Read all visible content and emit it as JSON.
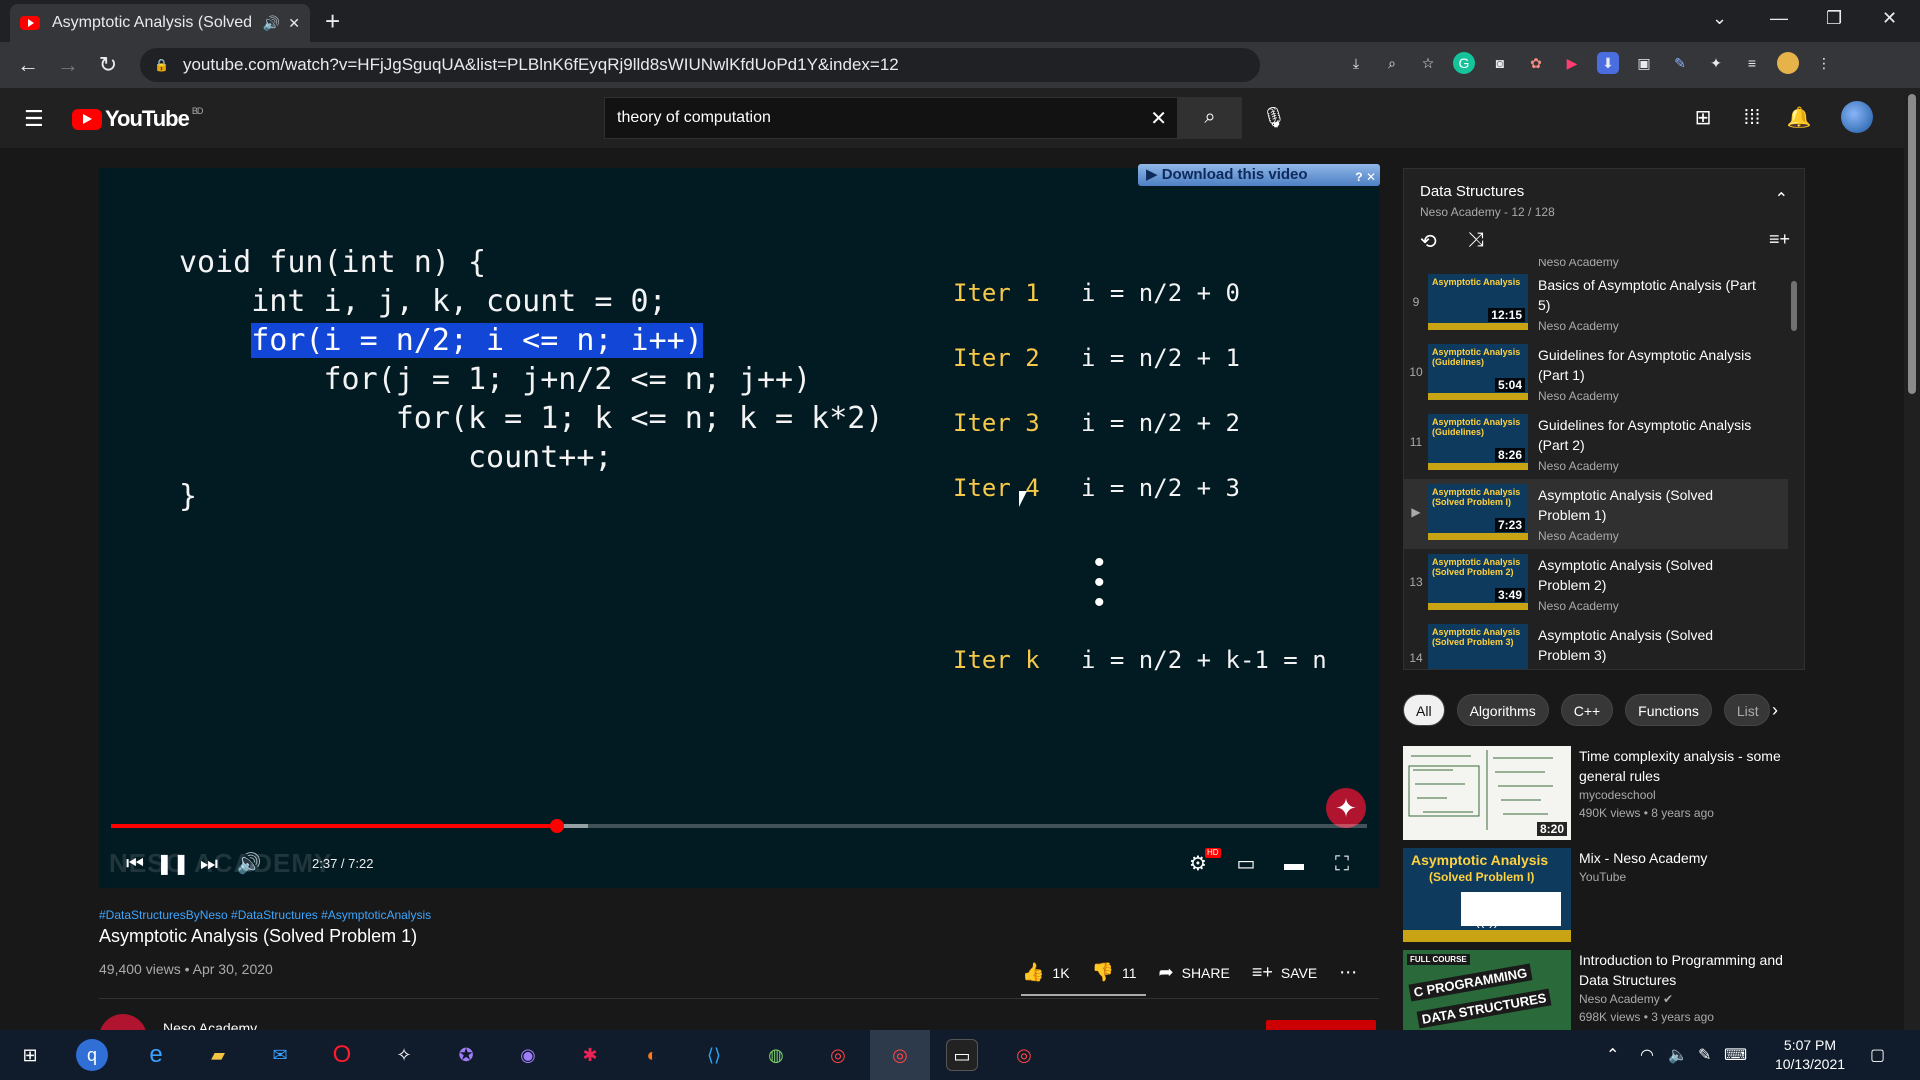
{
  "browser": {
    "tab_title": "Asymptotic Analysis (Solved",
    "url": "youtube.com/watch?v=HFjJgSguqUA&list=PLBlnK6fEyqRj9lld8sWIUNwlKfdUoPd1Y&index=12"
  },
  "header": {
    "logo_text": "YouTube",
    "logo_region": "BD",
    "search_value": "theory of computation"
  },
  "player": {
    "download_label": "▶ Download this video",
    "code_lines": [
      "void fun(int n) {",
      "    int i, j, k, count = 0;",
      "    for(i = n/2; i <= n; i++)",
      "        for(j = 1; j+n/2 <= n; j++)",
      "            for(k = 1; k <= n; k = k*2)",
      "                count++;",
      "",
      "}"
    ],
    "iterations": [
      {
        "label": "Iter 1",
        "expr": "i = n/2 + 0"
      },
      {
        "label": "Iter 2",
        "expr": "i = n/2 + 1"
      },
      {
        "label": "Iter 3",
        "expr": "i = n/2 + 2"
      },
      {
        "label": "Iter 4",
        "expr": "i = n/2 + 3"
      },
      {
        "label": "Iter k",
        "expr": "i = n/2 + k-1 = n"
      }
    ],
    "watermark": "NESO ACADEMY",
    "time": "2:37 / 7:22",
    "progress_fraction": 0.355,
    "hd_badge": "HD"
  },
  "video": {
    "hashtags": "#DataStructuresByNeso #DataStructures #AsymptoticAnalysis",
    "title": "Asymptotic Analysis (Solved Problem 1)",
    "meta": "49,400 views • Apr 30, 2020",
    "likes": "1K",
    "dislikes": "11",
    "share_label": "SHARE",
    "save_label": "SAVE"
  },
  "playlist": {
    "title": "Data Structures",
    "subtitle": "Neso Academy - 12 / 128",
    "partial_channel": "Neso Academy",
    "items": [
      {
        "index": "9",
        "title": "Basics of Asymptotic Analysis (Part 5)",
        "channel": "Neso Academy",
        "duration": "12:15",
        "thumb": "Asymptotic Analysis"
      },
      {
        "index": "10",
        "title": "Guidelines for Asymptotic Analysis (Part 1)",
        "channel": "Neso Academy",
        "duration": "5:04",
        "thumb": "Asymptotic Analysis (Guidelines)"
      },
      {
        "index": "11",
        "title": "Guidelines for Asymptotic Analysis (Part 2)",
        "channel": "Neso Academy",
        "duration": "8:26",
        "thumb": "Asymptotic Analysis (Guidelines)"
      },
      {
        "index": "▶",
        "title": "Asymptotic Analysis (Solved Problem 1)",
        "channel": "Neso Academy",
        "duration": "7:23",
        "thumb": "Asymptotic Analysis (Solved Problem I)"
      },
      {
        "index": "13",
        "title": "Asymptotic Analysis (Solved Problem 2)",
        "channel": "Neso Academy",
        "duration": "3:49",
        "thumb": "Asymptotic Analysis (Solved Problem 2)"
      },
      {
        "index": "14",
        "title": "Asymptotic Analysis (Solved Problem 3)",
        "channel": "",
        "duration": "",
        "thumb": "Asymptotic Analysis (Solved Problem 3)"
      }
    ]
  },
  "chips": [
    "All",
    "Algorithms",
    "C++",
    "Functions",
    "List"
  ],
  "recommendations": [
    {
      "title": "Time complexity analysis - some general rules",
      "channel": "mycodeschool",
      "meta": "490K views • 8 years ago",
      "duration": "8:20"
    },
    {
      "title": "Mix - Neso Academy",
      "channel": "YouTube",
      "meta": "",
      "duration": ""
    },
    {
      "title": "Introduction to Programming and Data Structures",
      "channel": "Neso Academy ✔",
      "meta": "698K views • 3 years ago",
      "duration": ""
    }
  ],
  "rec_thumb_texts": {
    "mix_title": "Asymptotic Analysis",
    "mix_sub": "(Solved Problem I)",
    "intro_line1": "C PROGRAMMING",
    "intro_line2": "DATA STRUCTURES",
    "intro_badge": "FULL COURSE"
  },
  "channel_partial": "Neso Academy",
  "taskbar": {
    "time": "5:07 PM",
    "date": "10/13/2021"
  }
}
